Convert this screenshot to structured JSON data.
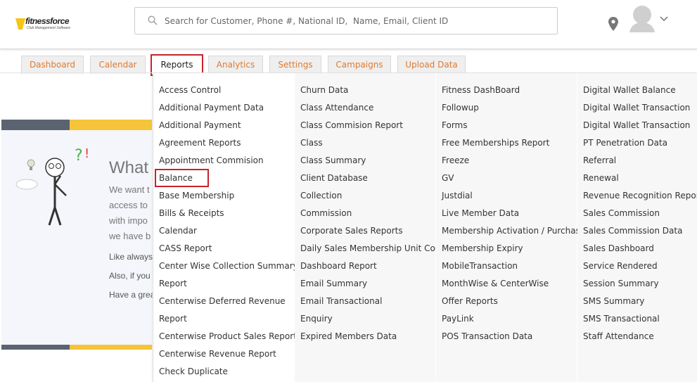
{
  "brand": {
    "name": "fitnessforce",
    "tagline": "Club Management Software"
  },
  "search": {
    "placeholder": "Search for Customer, Phone #, National ID,  Name, Email, Client ID"
  },
  "tabs": [
    {
      "label": "Dashboard"
    },
    {
      "label": "Calendar"
    },
    {
      "label": "Reports",
      "active": true
    },
    {
      "label": "Analytics"
    },
    {
      "label": "Settings"
    },
    {
      "label": "Campaigns"
    },
    {
      "label": "Upload Data"
    }
  ],
  "background_page": {
    "heading": "What",
    "lines": [
      "We want t",
      "access to",
      "with impo",
      "we have b"
    ],
    "small_lines": [
      "Like always",
      "Also, if you",
      "Have a grea"
    ]
  },
  "reports_menu": {
    "highlighted_item": "Balance",
    "columns": [
      [
        "Access Control",
        "Additional Payment Data",
        "Additional Payment",
        "Agreement Reports",
        "Appointment Commision",
        "Balance",
        "Base Membership",
        "Bills & Receipts",
        "Calendar",
        "CASS Report",
        "Center Wise Collection Summary",
        "Report",
        "Centerwise Deferred Revenue",
        "Report",
        "Centerwise Product Sales Report",
        "Centerwise Revenue Report",
        "Check Duplicate"
      ],
      [
        "Churn Data",
        "Class Attendance",
        "Class Commision Report",
        "Class",
        "Class Summary",
        "Client Database",
        "Collection",
        "Commission",
        "Corporate Sales Reports",
        "Daily Sales Membership Unit Count",
        "Dashboard Report",
        "Email Summary",
        "Email Transactional",
        "Enquiry",
        "Expired Members Data"
      ],
      [
        "Fitness DashBoard",
        "Followup",
        "Forms",
        "Free Memberships Report",
        "Freeze",
        "GV",
        "Justdial",
        "Live Member Data",
        "Membership Activation / Purchase",
        "Membership Expiry",
        "MobileTransaction",
        "MonthWise & CenterWise",
        "Offer Reports",
        "PayLink",
        "POS Transaction Data"
      ],
      [
        "Digital Wallet Balance",
        "Digital Wallet Transaction",
        "Digital Wallet Transaction",
        "PT Penetration Data",
        "Referral",
        "Renewal",
        "Revenue Recognition Report",
        "Sales Commission",
        "Sales Commission Data",
        "Sales Dashboard",
        "Service Rendered",
        "Session Summary",
        "SMS Summary",
        "SMS Transactional",
        "Staff Attendance"
      ]
    ]
  },
  "colors": {
    "tab_text": "#e07a2e",
    "highlight": "#c8232c",
    "bar_dark": "#5c6370",
    "bar_yellow": "#f6c43a"
  }
}
